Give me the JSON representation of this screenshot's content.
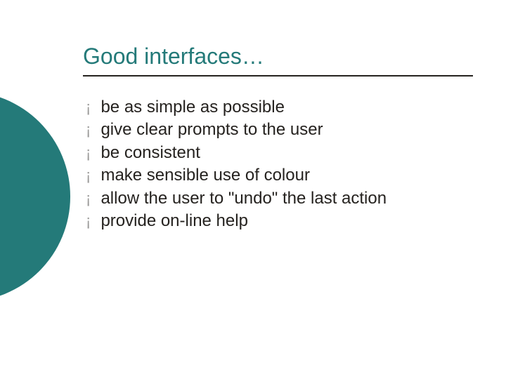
{
  "title": "Good interfaces…",
  "bullets": [
    "be as simple as possible",
    "give clear prompts to the user",
    "be consistent",
    "make sensible use of colour",
    "allow the user to \"undo\" the last action",
    "provide on-line help"
  ]
}
